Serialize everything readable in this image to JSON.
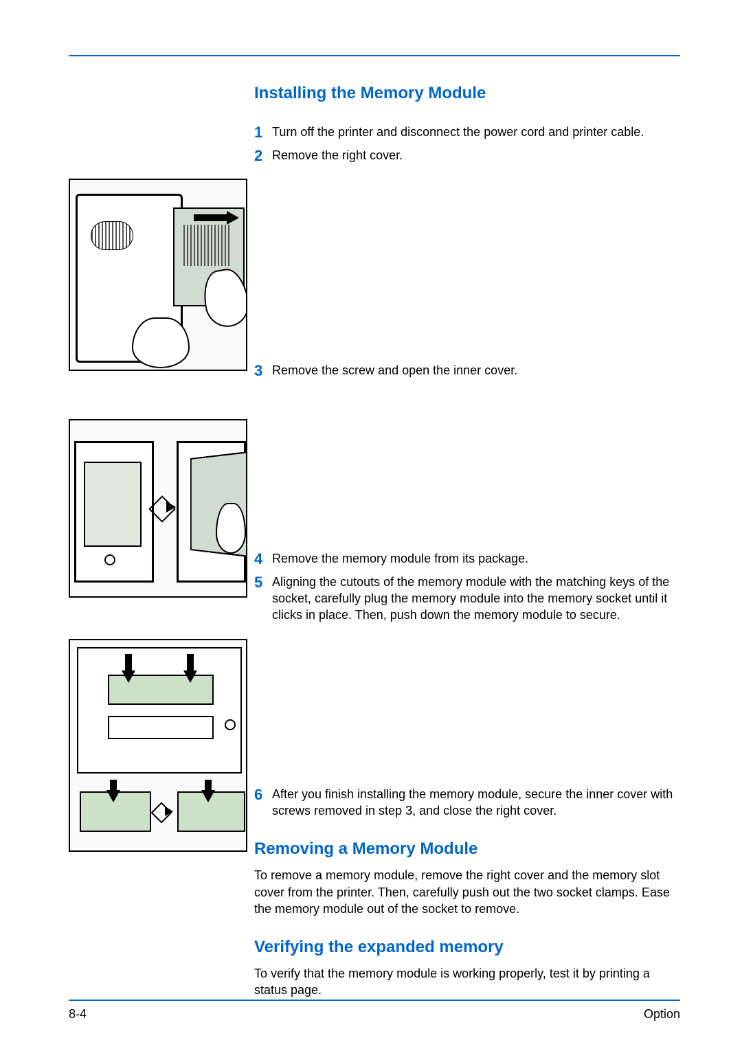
{
  "headings": {
    "installing": "Installing the Memory Module",
    "removing": "Removing a Memory Module",
    "verifying": "Verifying the expanded memory"
  },
  "steps": {
    "s1": "Turn off the printer and disconnect the power cord and printer cable.",
    "s2": "Remove the right cover.",
    "s3": "Remove the screw and open the inner cover.",
    "s4": "Remove the memory module from its package.",
    "s5": "Aligning the cutouts of the memory module with the matching keys of the socket, carefully plug the memory module into the memory socket until it clicks in place. Then, push down the memory module to secure.",
    "s6": "After you finish installing the memory module, secure the inner cover with screws removed in step 3, and close the right cover."
  },
  "nums": {
    "n1": "1",
    "n2": "2",
    "n3": "3",
    "n4": "4",
    "n5": "5",
    "n6": "6"
  },
  "removing_para": "To remove a memory module, remove the right cover and the memory slot cover from the printer. Then, carefully push out the two socket clamps. Ease the memory module out of the socket to remove.",
  "verifying_para": "To verify that the memory module is working properly, test it by printing a status page.",
  "footer": {
    "page": "8-4",
    "section": "Option"
  }
}
